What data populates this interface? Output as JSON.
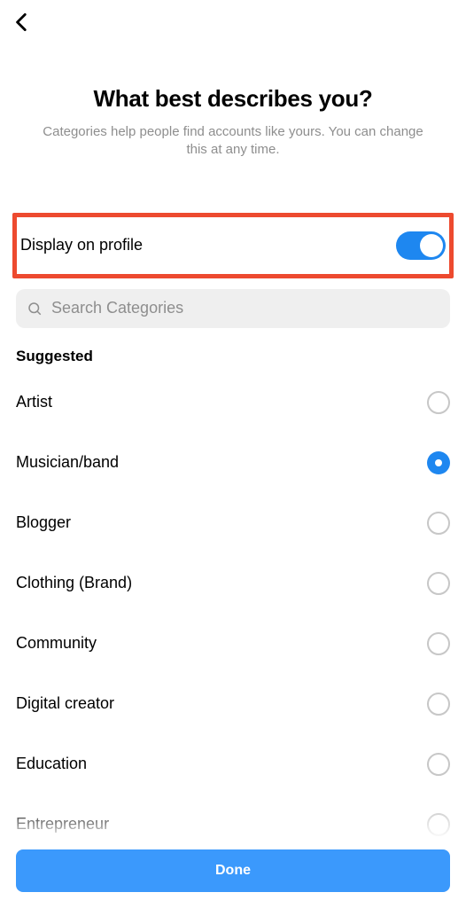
{
  "header": {
    "title": "What best describes you?",
    "subtitle": "Categories help people find accounts like yours. You can change this at any time."
  },
  "display_toggle": {
    "label": "Display on profile",
    "on": true
  },
  "search": {
    "placeholder": "Search Categories"
  },
  "section_title": "Suggested",
  "categories": [
    {
      "label": "Artist",
      "selected": false
    },
    {
      "label": "Musician/band",
      "selected": true
    },
    {
      "label": "Blogger",
      "selected": false
    },
    {
      "label": "Clothing (Brand)",
      "selected": false
    },
    {
      "label": "Community",
      "selected": false
    },
    {
      "label": "Digital creator",
      "selected": false
    },
    {
      "label": "Education",
      "selected": false
    },
    {
      "label": "Entrepreneur",
      "selected": false
    }
  ],
  "footer": {
    "done": "Done"
  },
  "colors": {
    "accent": "#1e87f0",
    "highlight_border": "#ed4a2f"
  }
}
